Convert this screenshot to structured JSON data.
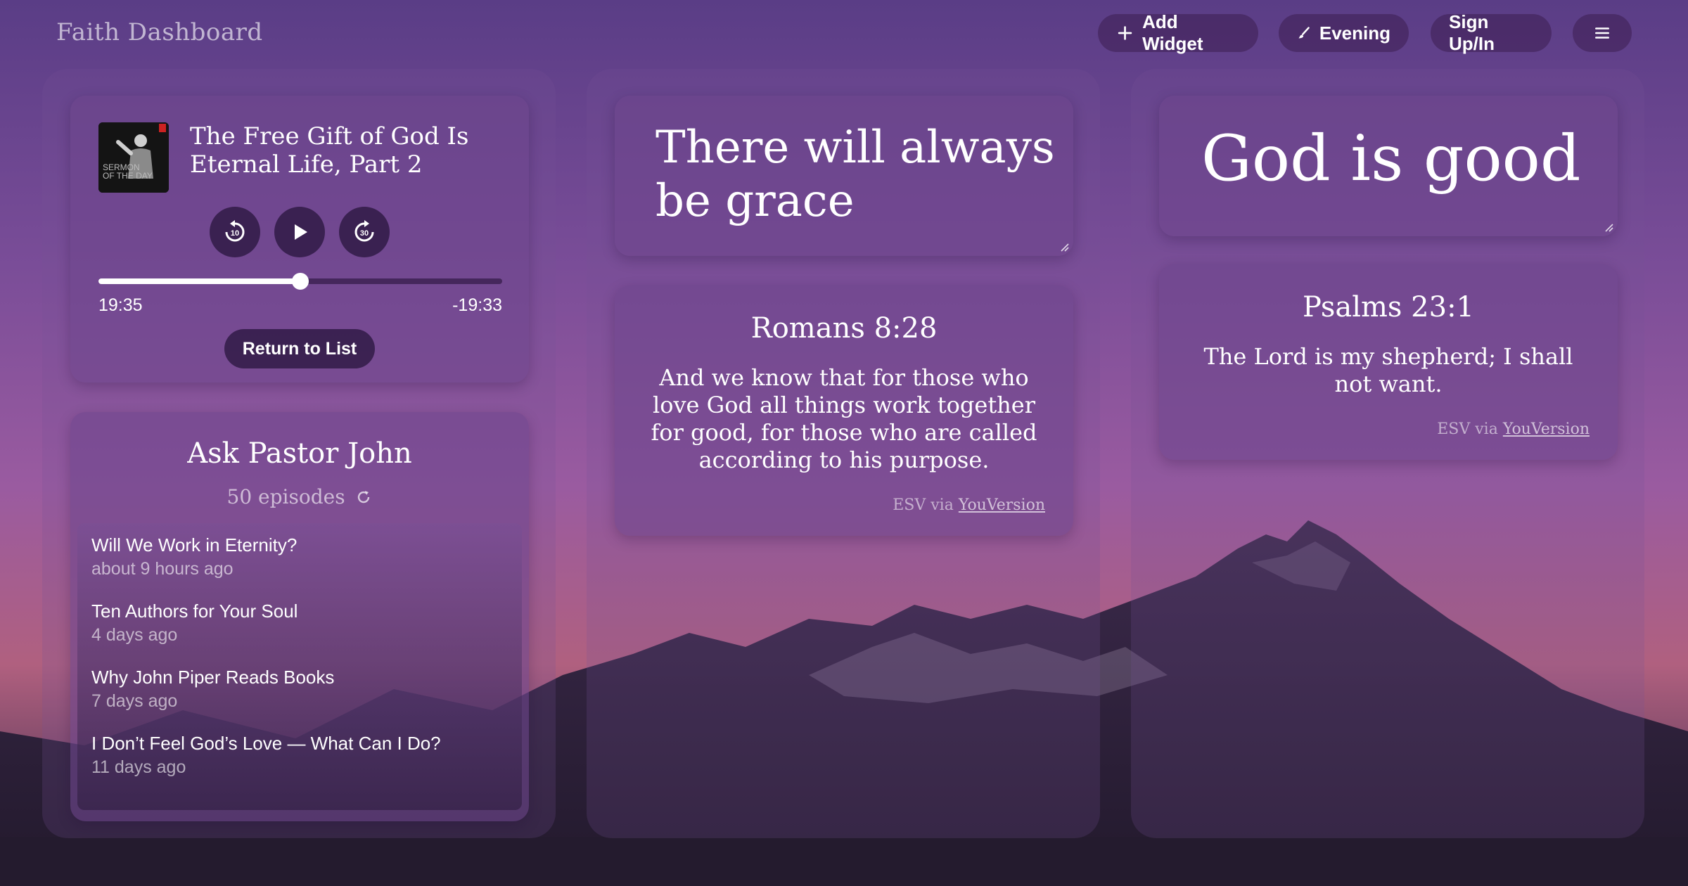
{
  "header": {
    "brand": "Faith Dashboard",
    "add_widget": "Add Widget",
    "theme": "Evening",
    "auth": "Sign Up/In"
  },
  "player": {
    "art_label": "SERMON\nOF THE DAY",
    "title": "The Free Gift of God Is Eternal Life, Part 2",
    "elapsed": "19:35",
    "remaining": "-19:33",
    "progress": 0.5,
    "return_label": "Return to List",
    "rewind_seconds": "10",
    "forward_seconds": "30"
  },
  "podcast": {
    "title": "Ask Pastor John",
    "count": "50 episodes",
    "episodes": [
      {
        "title": "Will We Work in Eternity?",
        "date": "about 9 hours ago"
      },
      {
        "title": "Ten Authors for Your Soul",
        "date": "4 days ago"
      },
      {
        "title": "Why John Piper Reads Books",
        "date": "7 days ago"
      },
      {
        "title": "I Don’t Feel God’s Love — What Can I Do?",
        "date": "11 days ago"
      }
    ]
  },
  "text_widgets": {
    "grace": "There will always be grace",
    "good": "God is good"
  },
  "verses": [
    {
      "ref": "Romans 8:28",
      "text": "And we know that for those who love God all things work together for good, for those who are called according to his purpose.",
      "source_prefix": "ESV via ",
      "source_link": "YouVersion"
    },
    {
      "ref": "Psalms 23:1",
      "text": "The Lord is my shepherd; I shall not want.",
      "source_prefix": "ESV via ",
      "source_link": "YouVersion"
    }
  ]
}
